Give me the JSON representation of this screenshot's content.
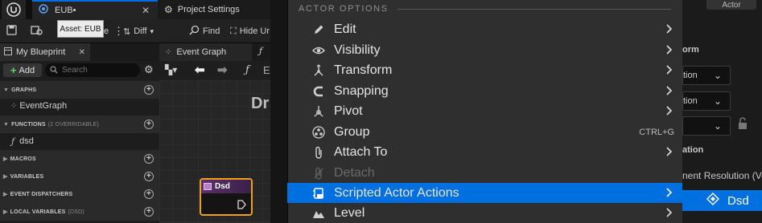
{
  "tabs": {
    "eub_label": "EUB•",
    "project_label": "Project Settings"
  },
  "toolbar": {
    "tooltip": "Asset: EUB",
    "diff_label": "Diff",
    "find_label": "Find",
    "hide_label": "Hide Ur",
    "partial_e": "e"
  },
  "my_blueprint": {
    "tab_label": "My Blueprint",
    "add_label": "Add",
    "search_placeholder": "Search",
    "graphs_header": "GRAPHS",
    "event_graph_item": "EventGraph",
    "functions_header": "FUNCTIONS",
    "functions_sub": "(2 OVERRIDABLE)",
    "function_item": "dsd",
    "macros_header": "MACROS",
    "variables_header": "VARIABLES",
    "dispatchers_header": "EVENT DISPATCHERS",
    "local_vars_header": "LOCAL VARIABLES",
    "local_vars_sub": "(DSD)"
  },
  "graph": {
    "tab_label": "Event Graph",
    "title_partial": "Dr",
    "toolbar_partial": "E",
    "node_title": "Dsd"
  },
  "menu": {
    "header": "ACTOR OPTIONS",
    "items": [
      {
        "label": "Edit",
        "icon": "pencil-icon",
        "submenu": true
      },
      {
        "label": "Visibility",
        "icon": "eye-icon",
        "submenu": true
      },
      {
        "label": "Transform",
        "icon": "transform-icon",
        "submenu": true
      },
      {
        "label": "Snapping",
        "icon": "magnet-icon",
        "submenu": true
      },
      {
        "label": "Pivot",
        "icon": "pivot-icon",
        "submenu": true
      },
      {
        "label": "Group",
        "icon": "group-icon",
        "shortcut": "CTRL+G"
      },
      {
        "label": "Attach To",
        "icon": "paperclip-icon",
        "submenu": true
      },
      {
        "label": "Detach",
        "icon": "detach-icon",
        "disabled": true
      },
      {
        "label": "Scripted Actor Actions",
        "icon": "scripted-actions-icon",
        "submenu": true,
        "highlighted": true
      },
      {
        "label": "Level",
        "icon": "level-icon",
        "submenu": true
      }
    ]
  },
  "right_panel": {
    "top_button": "Actor",
    "header_1": "orm",
    "field_1": "tion",
    "field_2": "tion",
    "header_2": "ation",
    "resolution_text": "nent Resolution (Ve",
    "dsd_label": "Dsd"
  },
  "colors": {
    "accent": "#0070e0",
    "node_border": "#f0a020",
    "node_header": "#5d2f6e"
  }
}
